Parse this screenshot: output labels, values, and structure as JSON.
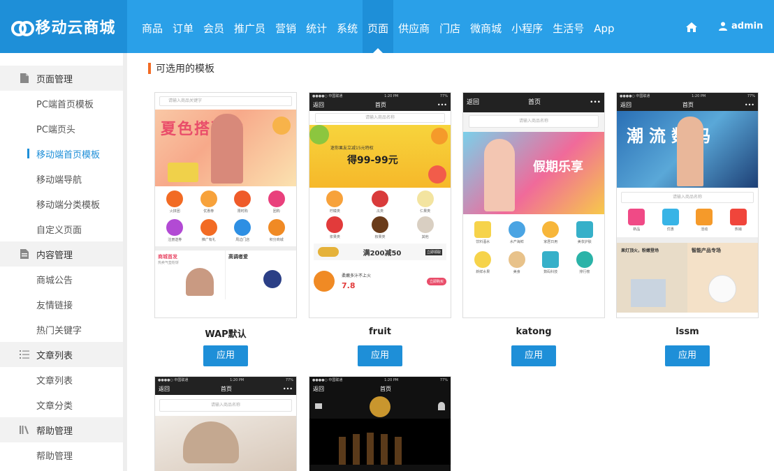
{
  "brand": {
    "name": "移动云商城"
  },
  "nav": {
    "items": [
      "商品",
      "订单",
      "会员",
      "推广员",
      "营销",
      "统计",
      "系统",
      "页面",
      "供应商",
      "门店",
      "微商城",
      "小程序",
      "生活号",
      "App"
    ],
    "active_index": 7
  },
  "user": {
    "name": "admin"
  },
  "sidebar": {
    "groups": [
      {
        "title": "页面管理",
        "icon": "page-icon",
        "items": [
          "PC端首页模板",
          "PC端页头",
          "移动端首页模板",
          "移动端导航",
          "移动端分类模板",
          "自定义页面"
        ]
      },
      {
        "title": "内容管理",
        "icon": "document-icon",
        "items": [
          "商城公告",
          "友情链接",
          "热门关键字"
        ]
      },
      {
        "title": "文章列表",
        "icon": "list-icon",
        "items": [
          "文章列表",
          "文章分类"
        ]
      },
      {
        "title": "帮助管理",
        "icon": "books-icon",
        "items": [
          "帮助管理"
        ]
      }
    ],
    "active_item": "移动端首页模板"
  },
  "main": {
    "section_title": "可选用的模板",
    "apply_label": "应用",
    "templates": [
      {
        "name": "WAP默认",
        "thumb": {
          "search": "请输入商品关键字",
          "banner": "夏色搭配季",
          "icons": [
            "火拼团",
            "优惠券",
            "限时购",
            "团购",
            "注册送券",
            "推广有礼",
            "周边门店",
            "积分商城"
          ],
          "promo_left": "商城首发",
          "promo_left_sub": "热卖气垫粉饼",
          "promo_right": "高调者爱"
        }
      },
      {
        "name": "fruit",
        "thumb": {
          "back": "返回",
          "title": "首页",
          "search": "请输入商品名称",
          "banner_top": "迷你果友立减15元特权",
          "banner_price": "得99-99元",
          "fruits": [
            "柠檬类",
            "瓜类",
            "仁果类",
            "浆果类",
            "核果类",
            "其他"
          ],
          "promo": "满200减50",
          "promo_btn": "立即领取",
          "item_title": "柔嫩多汁不上火",
          "item_price": "7.8",
          "item_btn": "立即购买"
        }
      },
      {
        "name": "katong",
        "thumb": {
          "back": "返回",
          "title": "首页",
          "search": "请输入商品名称",
          "banner": "假期乐享",
          "icons": [
            "饮料酒水",
            "水产海鲜",
            "家居日用",
            "美妆护肤",
            "新鲜水果",
            "美食",
            "数码科技",
            "排行榜"
          ]
        }
      },
      {
        "name": "lssm",
        "thumb": {
          "back": "返回",
          "title": "首页",
          "banner": "潮流数码",
          "search": "请输入商品名称",
          "icons": [
            "新品",
            "优惠",
            "活动",
            "热销"
          ],
          "card_left": "果灯顶火，粉嫩登场",
          "card_right": "智能产品专场"
        }
      },
      {
        "name": "",
        "thumb": {
          "back": "返回",
          "title": "首页",
          "search": "请输入商品名称"
        }
      },
      {
        "name": "",
        "thumb": {
          "back": "返回",
          "title": "首页"
        }
      }
    ]
  },
  "colors": {
    "header": "#2aa0e8",
    "header_active": "#1e8fd8",
    "accent": "#f26b24",
    "button": "#1e8fd8"
  }
}
